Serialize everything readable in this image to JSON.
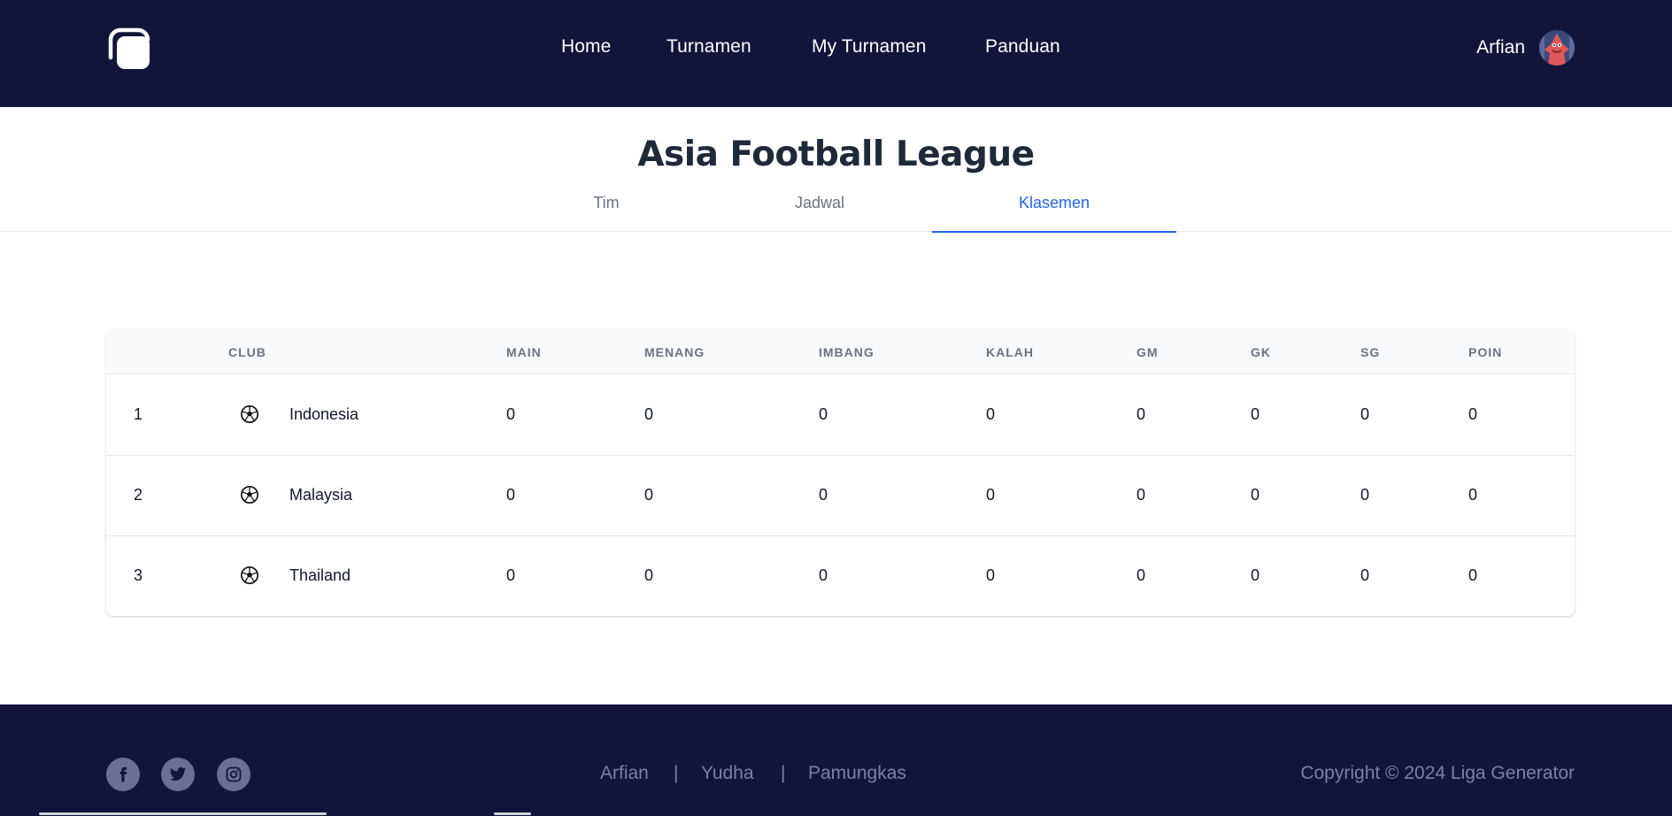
{
  "header": {
    "nav": [
      {
        "label": "Home"
      },
      {
        "label": "Turnamen"
      },
      {
        "label": "My Turnamen"
      },
      {
        "label": "Panduan"
      }
    ],
    "user_name": "Arfian"
  },
  "page": {
    "title": "Asia Football League",
    "tabs": [
      {
        "label": "Tim",
        "active": false
      },
      {
        "label": "Jadwal",
        "active": false
      },
      {
        "label": "Klasemen",
        "active": true
      }
    ]
  },
  "standings": {
    "columns": [
      "CLUB",
      "MAIN",
      "MENANG",
      "IMBANG",
      "KALAH",
      "GM",
      "GK",
      "SG",
      "POIN"
    ],
    "rows": [
      {
        "rank": "1",
        "club": "Indonesia",
        "main": "0",
        "menang": "0",
        "imbang": "0",
        "kalah": "0",
        "gm": "0",
        "gk": "0",
        "sg": "0",
        "poin": "0"
      },
      {
        "rank": "2",
        "club": "Malaysia",
        "main": "0",
        "menang": "0",
        "imbang": "0",
        "kalah": "0",
        "gm": "0",
        "gk": "0",
        "sg": "0",
        "poin": "0"
      },
      {
        "rank": "3",
        "club": "Thailand",
        "main": "0",
        "menang": "0",
        "imbang": "0",
        "kalah": "0",
        "gm": "0",
        "gk": "0",
        "sg": "0",
        "poin": "0"
      }
    ]
  },
  "footer": {
    "social_icons": [
      "facebook-icon",
      "twitter-icon",
      "instagram-icon"
    ],
    "links": [
      "Arfian",
      "Yudha",
      "Pamungkas"
    ],
    "separator": "|",
    "copyright": "Copyright © 2024 Liga Generator"
  },
  "colors": {
    "header_bg": "#13143a",
    "accent": "#2563eb",
    "footer_text": "#7c80a8"
  }
}
